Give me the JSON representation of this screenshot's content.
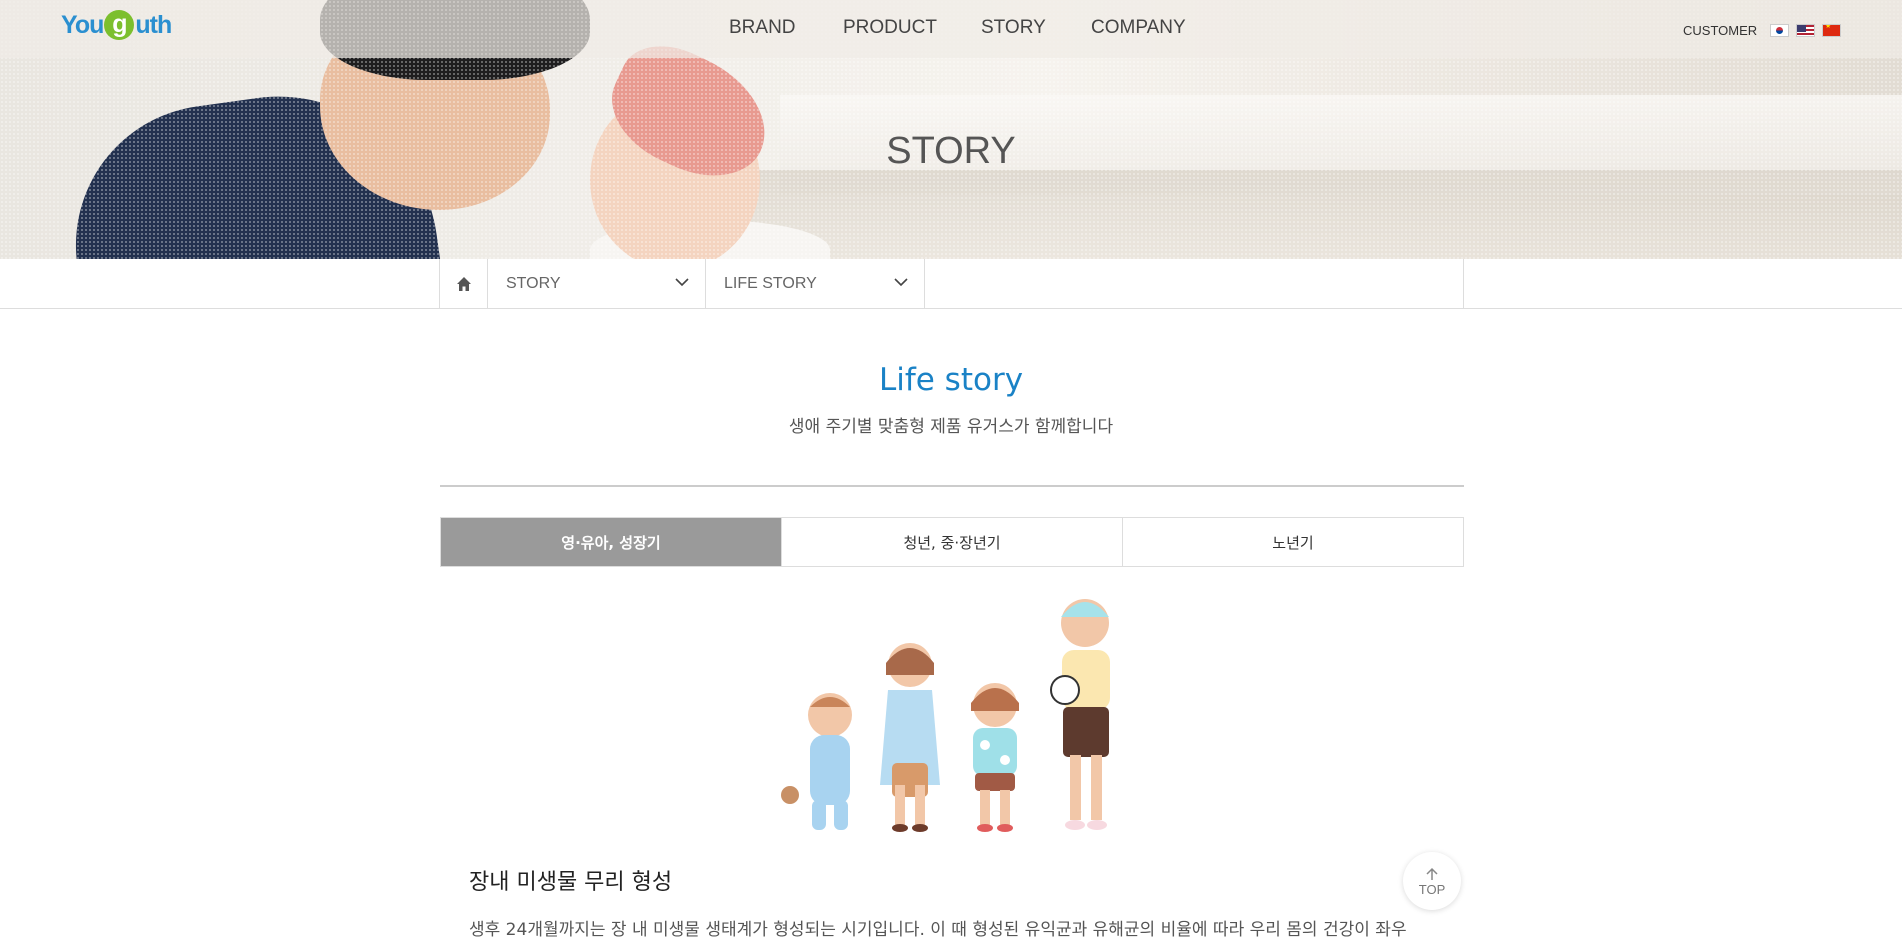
{
  "brand": {
    "logo_prefix": "You",
    "logo_g": "g",
    "logo_suffix": "uth"
  },
  "nav": {
    "items": [
      "BRAND",
      "PRODUCT",
      "STORY",
      "COMPANY"
    ],
    "customer": "CUSTOMER",
    "languages": [
      "korean-flag-icon",
      "us-flag-icon",
      "china-flag-icon"
    ]
  },
  "hero": {
    "title": "STORY"
  },
  "breadcrumb": {
    "level1": "STORY",
    "level2": "LIFE STORY"
  },
  "section": {
    "title": "Life story",
    "subtitle": "생애 주기별 맞춤형 제품 유거스가 함께합니다"
  },
  "tabs": [
    {
      "label": "영·유아, 성장기",
      "active": true
    },
    {
      "label": "청년, 중·장년기",
      "active": false
    },
    {
      "label": "노년기",
      "active": false
    }
  ],
  "content": {
    "title": "장내 미생물 무리 형성",
    "body": "생후 24개월까지는 장 내 미생물 생태계가 형성되는 시기입니다. 이 때 형성된 유익균과 유해균의 비율에 따라 우리 몸의 건강이 좌우"
  },
  "top_button": {
    "label": "TOP"
  },
  "colors": {
    "accent": "#1a82c6",
    "logo_green": "#7cbf2e",
    "tab_active": "#9a9a9a"
  }
}
